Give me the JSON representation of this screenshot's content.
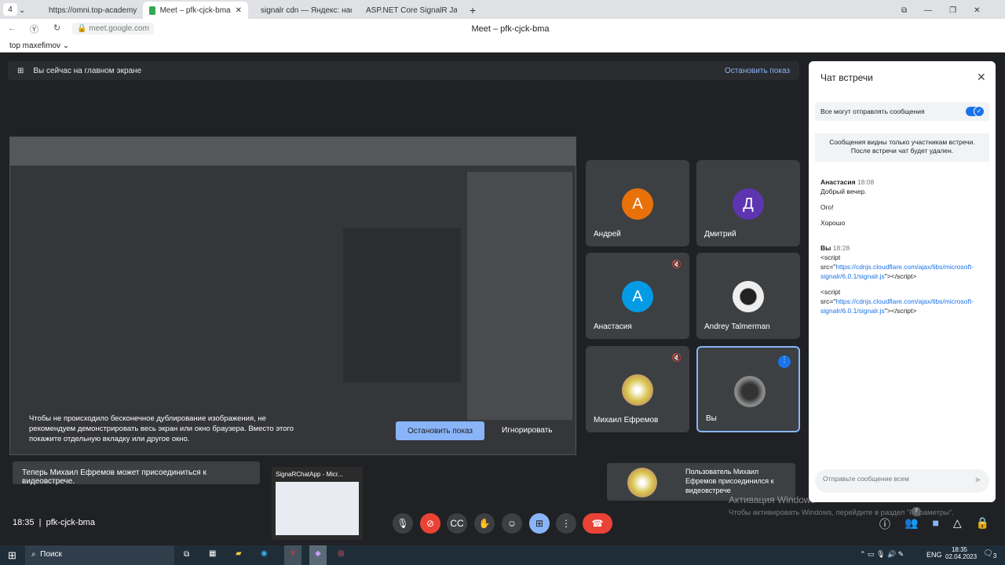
{
  "browser": {
    "tab_count": "4",
    "tabs": [
      {
        "label": "https://omni.top-academy"
      },
      {
        "label": "Meet – pfk-cjck-bma"
      },
      {
        "label": "signalr cdn — Яндекс: нас"
      },
      {
        "label": "ASP.NET Core SignalR Jav"
      }
    ],
    "url": "meet.google.com",
    "page_title": "Meet – pfk-cjck-bma",
    "profile": "top maxefimov"
  },
  "banner": {
    "text": "Вы сейчас на главном экране",
    "stop": "Остановить показ"
  },
  "share_warning": {
    "text": "Чтобы не происходило бесконечное дублирование изображения, не рекомендуем демонстрировать весь экран или окно браузера. Вместо этого покажите отдельную вкладку или другое окно.",
    "stop": "Остановить показ",
    "ignore": "Игнорировать"
  },
  "participants": [
    {
      "name": "Андрей",
      "initial": "А",
      "color": "#e8710a",
      "muted": false
    },
    {
      "name": "Дмитрий",
      "initial": "Д",
      "color": "#5e35b1",
      "muted": false
    },
    {
      "name": "Анастасия",
      "initial": "А",
      "color": "#039be5",
      "muted": true
    },
    {
      "name": "Andrey Talmerman",
      "initial": "",
      "color": "#ddd",
      "muted": false
    },
    {
      "name": "Михаил Ефремов",
      "initial": "",
      "color": "#c9b545",
      "muted": true
    },
    {
      "name": "Вы",
      "initial": "",
      "color": "#666",
      "muted": false,
      "speaking": true
    }
  ],
  "toast": "Теперь Михаил Ефремов может присоединиться к видеовстрече.",
  "taskbar_preview": "SignaRChatApp - Micr...",
  "join_notice": "Пользователь Михаил Ефремов присоединился к видеовстрече",
  "chat": {
    "title": "Чат встречи",
    "toggle_label": "Все могут отправлять сообщения",
    "toggle_on": true,
    "info": "Сообщения видны только участникам встречи. После встречи чат будет удален.",
    "groups": [
      {
        "author": "Анастасия",
        "time": "18:08",
        "messages": [
          "Добрый вечер.",
          "Ого!",
          "Хорошо"
        ]
      },
      {
        "author": "Вы",
        "time": "18:28",
        "pre": "<script src=\"",
        "link": "https://cdnjs.cloudflare.com/ajax/libs/microsoft-signalr/6.0.1/signalr.js",
        "post": "\"></script>"
      }
    ],
    "placeholder": "Отправьте сообщение всем"
  },
  "meeting": {
    "time": "18:35",
    "code": "pfk-cjck-bma"
  },
  "watermark": {
    "title": "Активация Windows",
    "text": "Чтобы активировать Windows, перейдите в раздел \"Параметры\"."
  },
  "side_badge": "7",
  "system": {
    "search": "Поиск",
    "lang": "ENG",
    "time": "18:35",
    "date": "02.04.2023",
    "notifications": "3"
  },
  "colors": {
    "accent": "#8ab4f8",
    "end_call": "#ea4335",
    "bg": "#202124"
  }
}
